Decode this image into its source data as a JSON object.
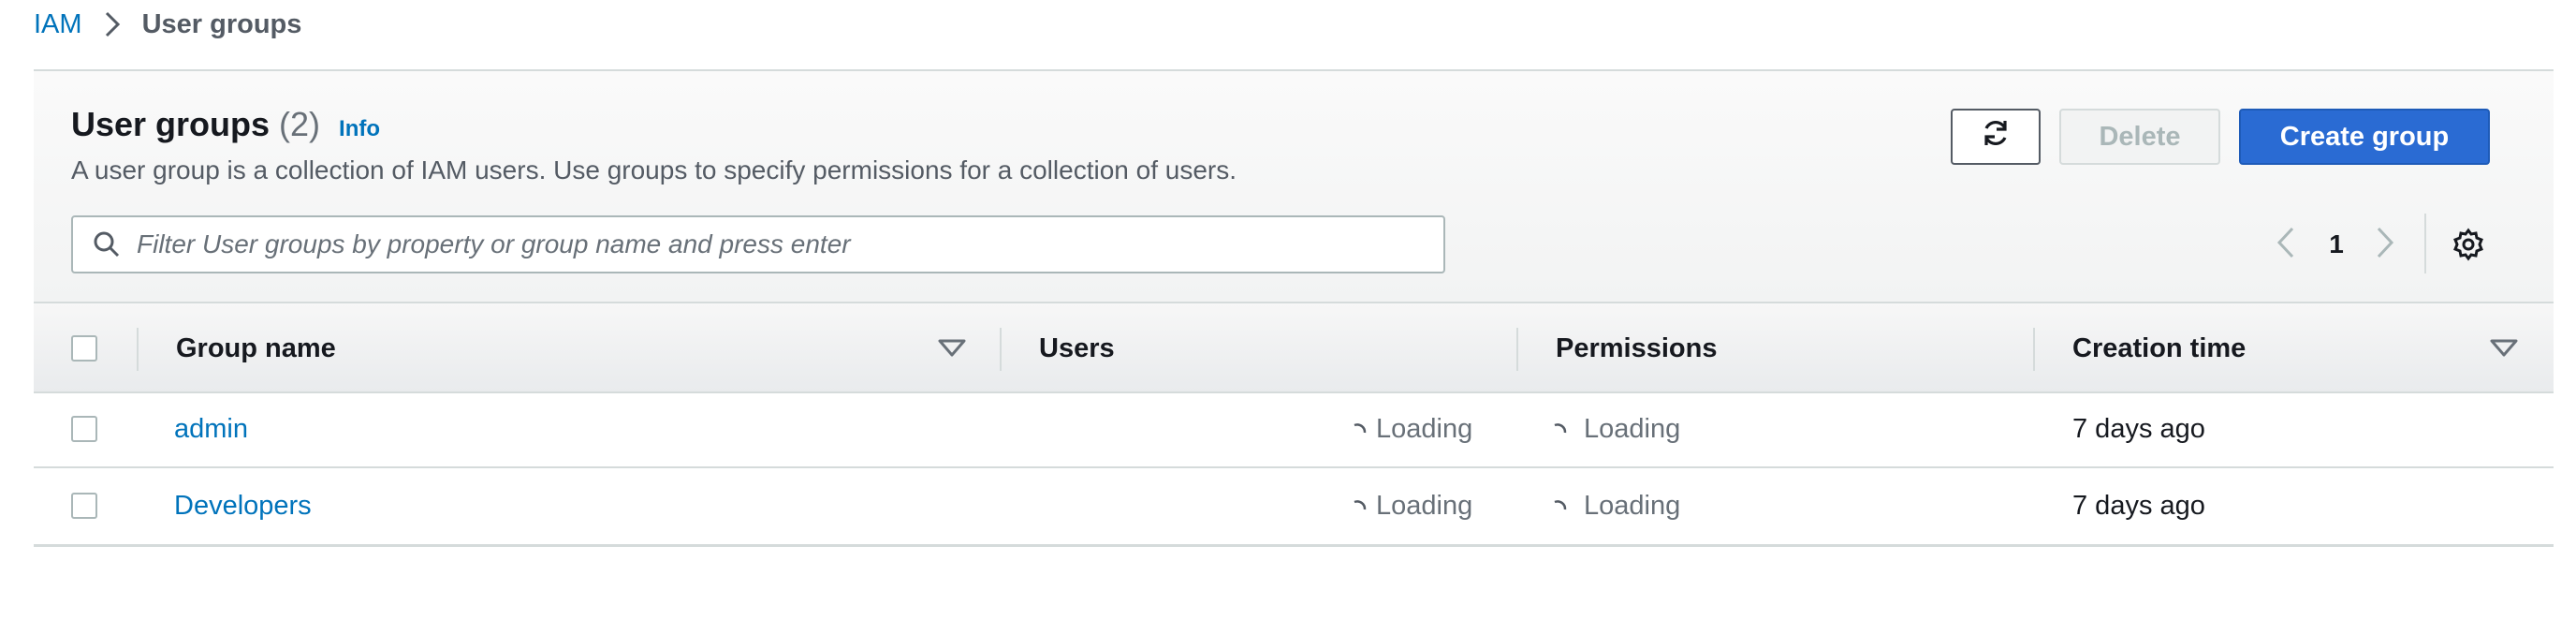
{
  "breadcrumb": {
    "root": "IAM",
    "current": "User groups"
  },
  "header": {
    "title": "User groups",
    "count": "(2)",
    "info": "Info",
    "description": "A user group is a collection of IAM users. Use groups to specify permissions for a collection of users."
  },
  "actions": {
    "refresh_icon": "refresh-icon",
    "delete_label": "Delete",
    "create_label": "Create group"
  },
  "search": {
    "placeholder": "Filter User groups by property or group name and press enter",
    "value": ""
  },
  "pagination": {
    "current_page": "1"
  },
  "table": {
    "columns": [
      "Group name",
      "Users",
      "Permissions",
      "Creation time"
    ],
    "rows": [
      {
        "name": "admin",
        "users": "Loading",
        "permissions": "Loading",
        "created": "7 days ago"
      },
      {
        "name": "Developers",
        "users": "Loading",
        "permissions": "Loading",
        "created": "7 days ago"
      }
    ]
  },
  "colors": {
    "link": "#0073bb",
    "primary_button": "#2a6bd3",
    "muted_text": "#687078",
    "border": "#d5dbdb"
  }
}
